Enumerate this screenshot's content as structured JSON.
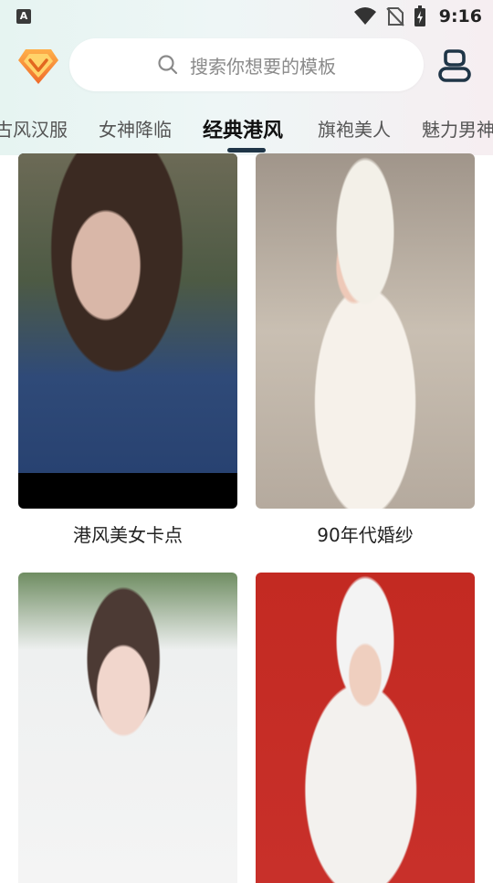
{
  "status_bar": {
    "app_indicator": "A",
    "time": "9:16"
  },
  "header": {
    "search": {
      "placeholder": "搜索你想要的模板"
    }
  },
  "tabs": [
    {
      "label": "古风汉服",
      "active": false
    },
    {
      "label": "女神降临",
      "active": false
    },
    {
      "label": "经典港风",
      "active": true
    },
    {
      "label": "旗袍美人",
      "active": false
    },
    {
      "label": "魅力男神",
      "active": false
    }
  ],
  "templates": [
    {
      "label": "港风美女卡点"
    },
    {
      "label": "90年代婚纱"
    },
    {
      "label": ""
    },
    {
      "label": ""
    }
  ],
  "colors": {
    "accent": "#1f3547",
    "vip_badge": "#f08a2a"
  }
}
